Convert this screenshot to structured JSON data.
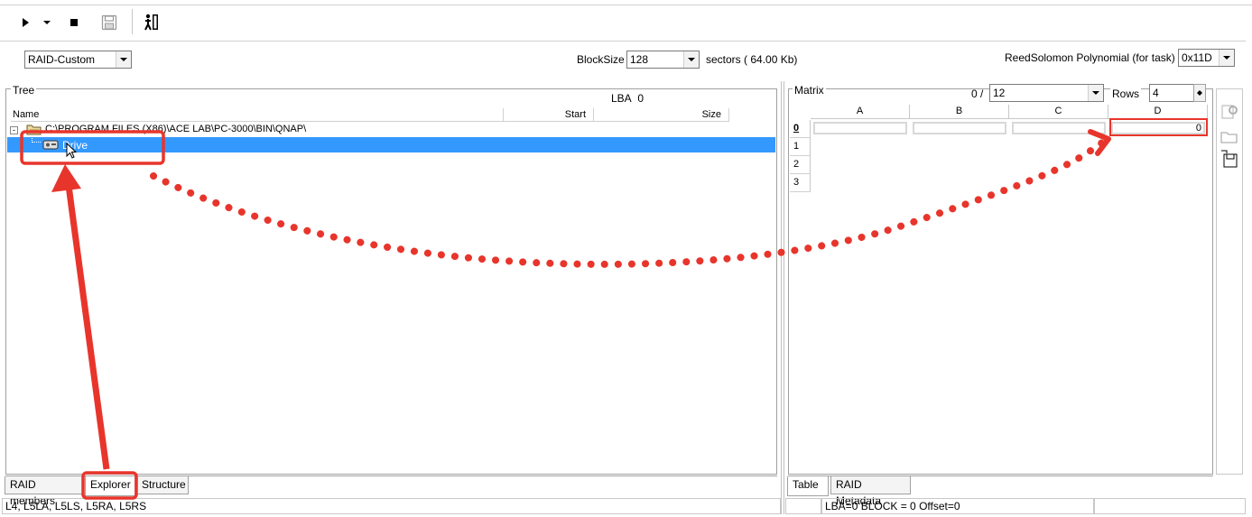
{
  "toolbar": {
    "play_icon": "play-icon",
    "dropdown_icon": "dropdown-icon",
    "stop_icon": "stop-icon",
    "save_icon": "save-icon",
    "exit_icon": "exit-icon"
  },
  "settings": {
    "raid_type": "RAID-Custom",
    "blocksize_label": "BlockSize",
    "blocksize_value": "128",
    "sectors_text": "sectors ( 64.00 Kb)",
    "polynomial_label": "ReedSolomon Polynomial (for task)",
    "polynomial_value": "0x11D"
  },
  "tree": {
    "title": "Tree",
    "lba_label": "LBA",
    "lba_value": "0",
    "columns": [
      "Name",
      "Start",
      "Size"
    ],
    "root_path": "C:\\PROGRAM FILES (X86)\\ACE LAB\\PC-3000\\BIN\\QNAP\\",
    "child_label": "Drive"
  },
  "left_tabs": [
    "RAID members",
    "Explorer",
    "Structure"
  ],
  "left_status": "L4, L5LA, L5LS, L5RA, L5RS",
  "matrix": {
    "title": "Matrix",
    "position_text": "0 /",
    "position_value": "12",
    "rows_label": "Rows",
    "rows_value": "4",
    "columns": [
      "A",
      "B",
      "C",
      "D"
    ],
    "row_indices": [
      "0",
      "1",
      "2",
      "3"
    ],
    "cell_d0_value": "0"
  },
  "right_tabs": [
    "Table",
    "RAID Metadata"
  ],
  "right_status": "LBA=0 BLOCK = 0 Offset=0",
  "colors": {
    "selection": "#3399ff",
    "annotation": "#e8352c"
  }
}
